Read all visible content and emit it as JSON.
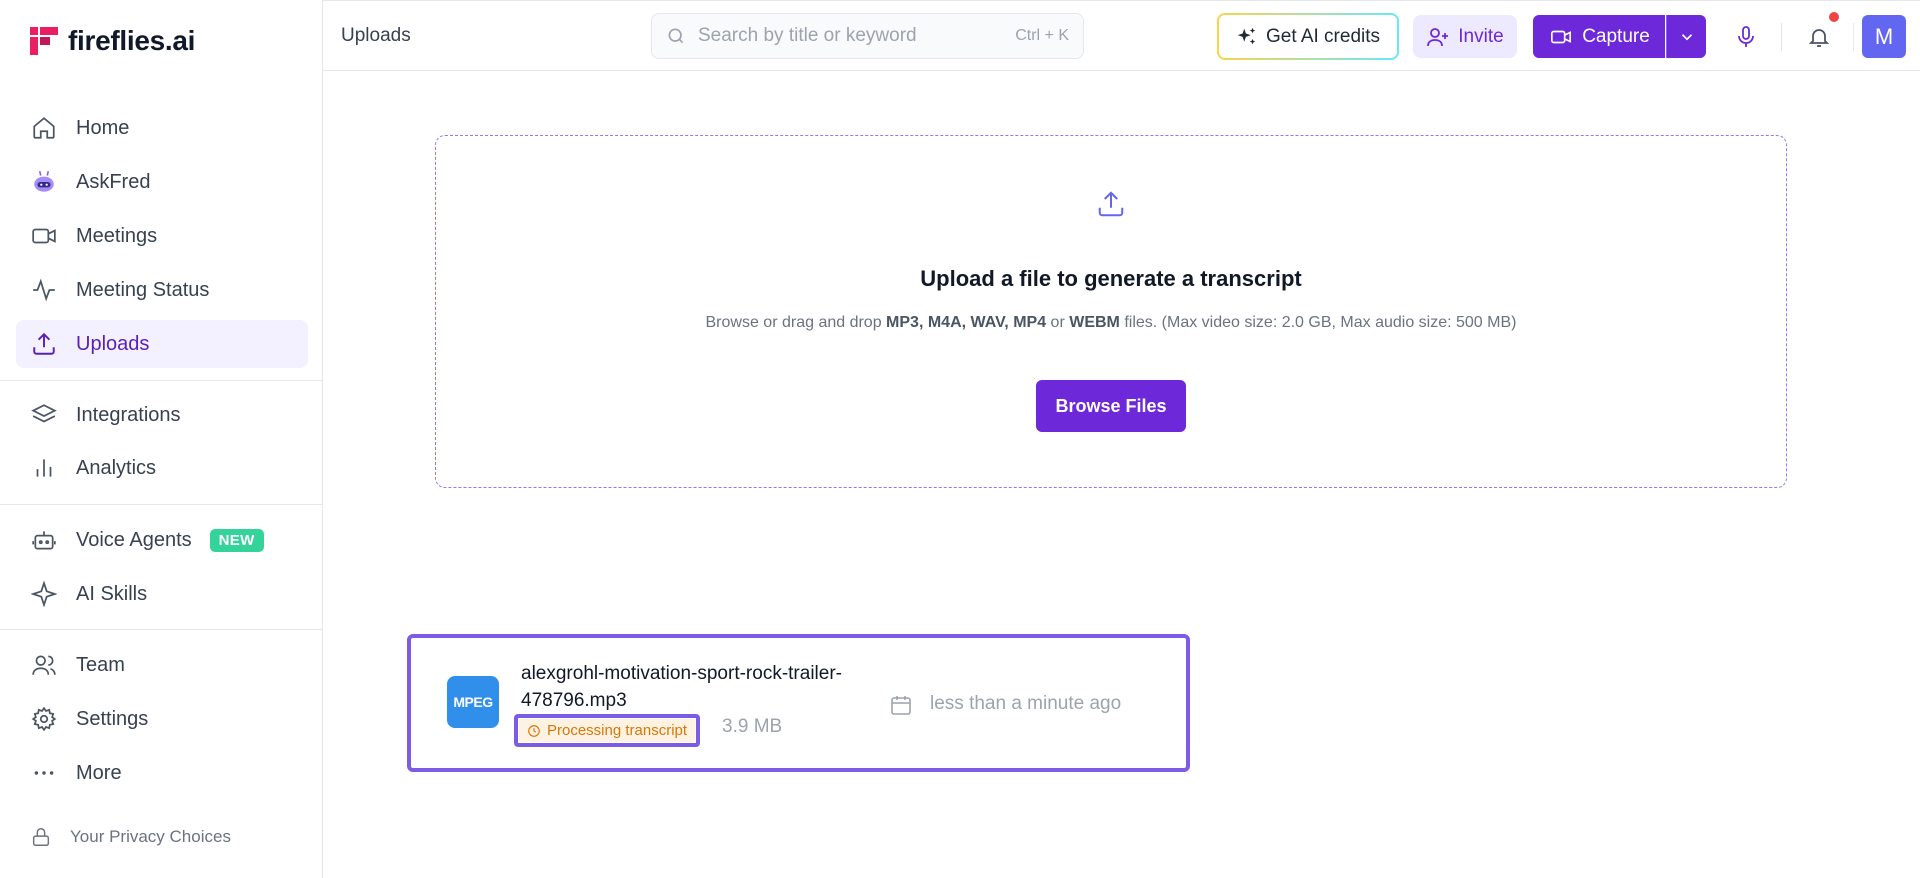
{
  "brand": {
    "name": "fireflies.ai"
  },
  "sidebar": {
    "items": [
      {
        "label": "Home",
        "icon": "home-icon"
      },
      {
        "label": "AskFred",
        "icon": "robot-icon"
      },
      {
        "label": "Meetings",
        "icon": "video-icon"
      },
      {
        "label": "Meeting Status",
        "icon": "activity-icon"
      },
      {
        "label": "Uploads",
        "icon": "upload-icon",
        "active": true
      },
      {
        "label": "Integrations",
        "icon": "layers-icon"
      },
      {
        "label": "Analytics",
        "icon": "bar-chart-icon"
      },
      {
        "label": "Voice Agents",
        "icon": "bot-icon",
        "badge": "NEW"
      },
      {
        "label": "AI Skills",
        "icon": "sparkle-icon"
      },
      {
        "label": "Team",
        "icon": "users-icon"
      },
      {
        "label": "Settings",
        "icon": "gear-icon"
      },
      {
        "label": "More",
        "icon": "dots-icon"
      }
    ],
    "privacy": "Your Privacy Choices"
  },
  "header": {
    "title": "Uploads",
    "search_placeholder": "Search by title or keyword",
    "search_shortcut": "Ctrl + K",
    "credits_label": "Get AI credits",
    "invite_label": "Invite",
    "capture_label": "Capture",
    "avatar_initial": "M"
  },
  "dropzone": {
    "title": "Upload a file to generate a transcript",
    "subtitle_prefix": "Browse or drag and drop ",
    "formats": "MP3, M4A, WAV, MP4",
    "or": " or ",
    "format_last": "WEBM",
    "subtitle_suffix": " files. (Max video size: 2.0 GB, Max audio size: 500 MB)",
    "browse_label": "Browse Files"
  },
  "file": {
    "thumb": "MPEG",
    "name": "alexgrohl-motivation-sport-rock-trailer-478796.mp3",
    "status": "Processing transcript",
    "size": "3.9 MB",
    "time": "less than a minute ago"
  },
  "colors": {
    "accent": "#6d28d9",
    "active_bg": "#f3f0ff",
    "badge_new": "#34d399",
    "status": "#d97706"
  }
}
